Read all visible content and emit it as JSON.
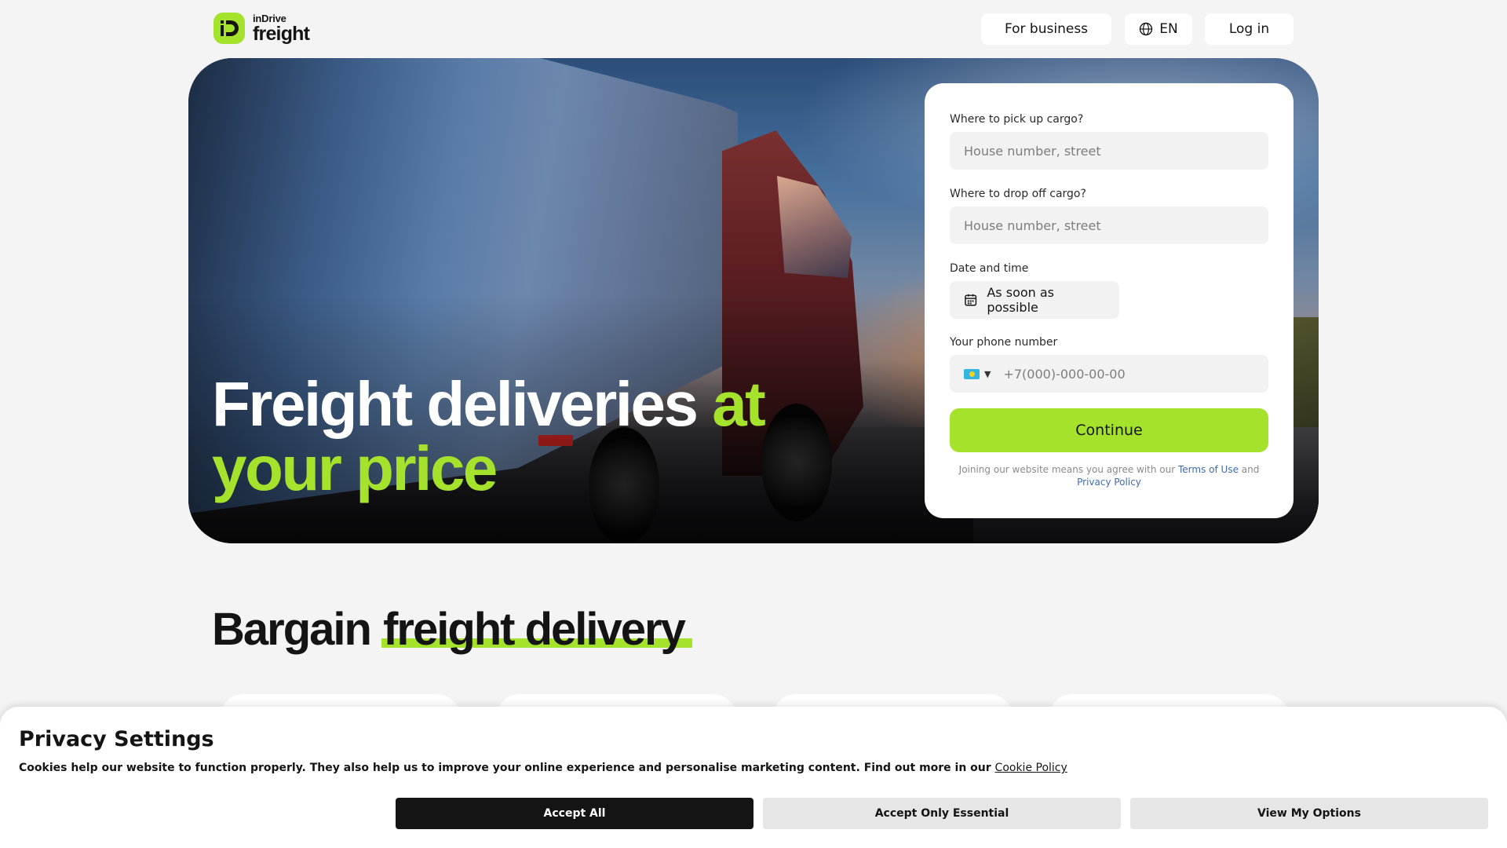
{
  "header": {
    "logo_brand": "inDrive",
    "logo_product": "freight",
    "logo_mark": "iD",
    "for_business_label": "For business",
    "language_label": "EN",
    "login_label": "Log in"
  },
  "hero": {
    "title_part1": "Freight deliveries ",
    "title_accent": "at your price"
  },
  "form": {
    "pickup_label": "Where to pick up cargo?",
    "pickup_placeholder": "House number, street",
    "dropoff_label": "Where to drop off cargo?",
    "dropoff_placeholder": "House number, street",
    "date_label": "Date and time",
    "date_value": "As soon as possible",
    "phone_label": "Your phone number",
    "phone_placeholder": "+7(000)-000-00-00",
    "continue_label": "Continue",
    "terms_prefix": "Joining our website means you agree with our ",
    "terms_link": "Terms of Use",
    "terms_and": " and",
    "privacy_link": "Privacy Policy"
  },
  "section": {
    "title_plain": "Bargain ",
    "title_highlight": "freight delivery"
  },
  "cookie": {
    "title": "Privacy Settings",
    "text": "Cookies help our website to function properly. They also help us to improve your online experience and personalise marketing content. Find out more in our ",
    "policy_link": "Cookie Policy",
    "accept_all": "Accept All",
    "accept_essential": "Accept Only Essential",
    "view_options": "View My Options"
  },
  "colors": {
    "accent": "#a5e22b",
    "dark": "#141414",
    "link": "#3d6bb3"
  },
  "icons": {
    "globe": "globe-icon",
    "calendar": "calendar-icon",
    "flag": "kazakhstan-flag-icon",
    "caret": "caret-down-icon"
  }
}
